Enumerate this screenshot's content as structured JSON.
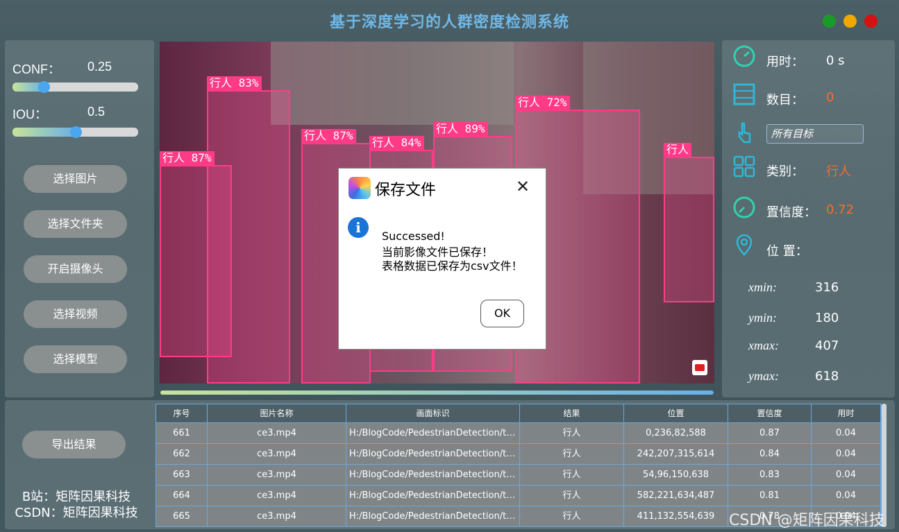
{
  "title": "基于深度学习的人群密度检测系统",
  "params": {
    "conf_label": "CONF：",
    "conf_value": "0.25",
    "conf_fraction": 0.25,
    "iou_label": "IOU：",
    "iou_value": "0.5",
    "iou_fraction": 0.5
  },
  "buttons": {
    "select_image": "选择图片",
    "select_folder": "选择文件夹",
    "open_camera": "开启摄像头",
    "select_video": "选择视频",
    "select_model": "选择模型",
    "export": "导出结果"
  },
  "detections": [
    {
      "label": "行人 83%"
    },
    {
      "label": "行人 87%"
    },
    {
      "label": "行人 87%"
    },
    {
      "label": "行人 84%"
    },
    {
      "label": "行人 89%"
    },
    {
      "label": "行人 72%"
    },
    {
      "label": "行人"
    }
  ],
  "dialog": {
    "title": "保存文件",
    "close": "✕",
    "info_icon": "i",
    "line1": "Successed!",
    "line2": "当前影像文件已保存！",
    "line3": "表格数据已保存为csv文件！",
    "ok": "OK"
  },
  "info": {
    "time_label": "用时：",
    "time_value": "0 s",
    "count_label": "数目：",
    "count_value": "0",
    "target_filter": "所有目标",
    "class_label": "类别：",
    "class_value": "行人",
    "conf_label": "置信度：",
    "conf_value": "0.72",
    "position_label": "位 置：",
    "xmin_label": "xmin:",
    "xmin_value": "316",
    "ymin_label": "ymin:",
    "ymin_value": "180",
    "xmax_label": "xmax:",
    "xmax_value": "407",
    "ymax_label": "ymax:",
    "ymax_value": "618"
  },
  "accent_value_color": "#ff6a2a",
  "credits": {
    "bilibili": "B站：矩阵因果科技",
    "csdn": "CSDN：矩阵因果科技"
  },
  "table": {
    "headers": [
      "序号",
      "图片名称",
      "画面标识",
      "结果",
      "位置",
      "置信度",
      "用时"
    ],
    "rows": [
      [
        "661",
        "ce3.mp4",
        "H:/BlogCode/PedestrianDetection/te...",
        "行人",
        "0,236,82,588",
        "0.87",
        "0.04"
      ],
      [
        "662",
        "ce3.mp4",
        "H:/BlogCode/PedestrianDetection/te...",
        "行人",
        "242,207,315,614",
        "0.84",
        "0.04"
      ],
      [
        "663",
        "ce3.mp4",
        "H:/BlogCode/PedestrianDetection/te...",
        "行人",
        "54,96,150,638",
        "0.83",
        "0.04"
      ],
      [
        "664",
        "ce3.mp4",
        "H:/BlogCode/PedestrianDetection/te...",
        "行人",
        "582,221,634,487",
        "0.81",
        "0.04"
      ],
      [
        "665",
        "ce3.mp4",
        "H:/BlogCode/PedestrianDetection/te...",
        "行人",
        "411,132,554,639",
        "0.78",
        "0.04"
      ]
    ]
  },
  "watermark": "CSDN @矩阵因果科技"
}
